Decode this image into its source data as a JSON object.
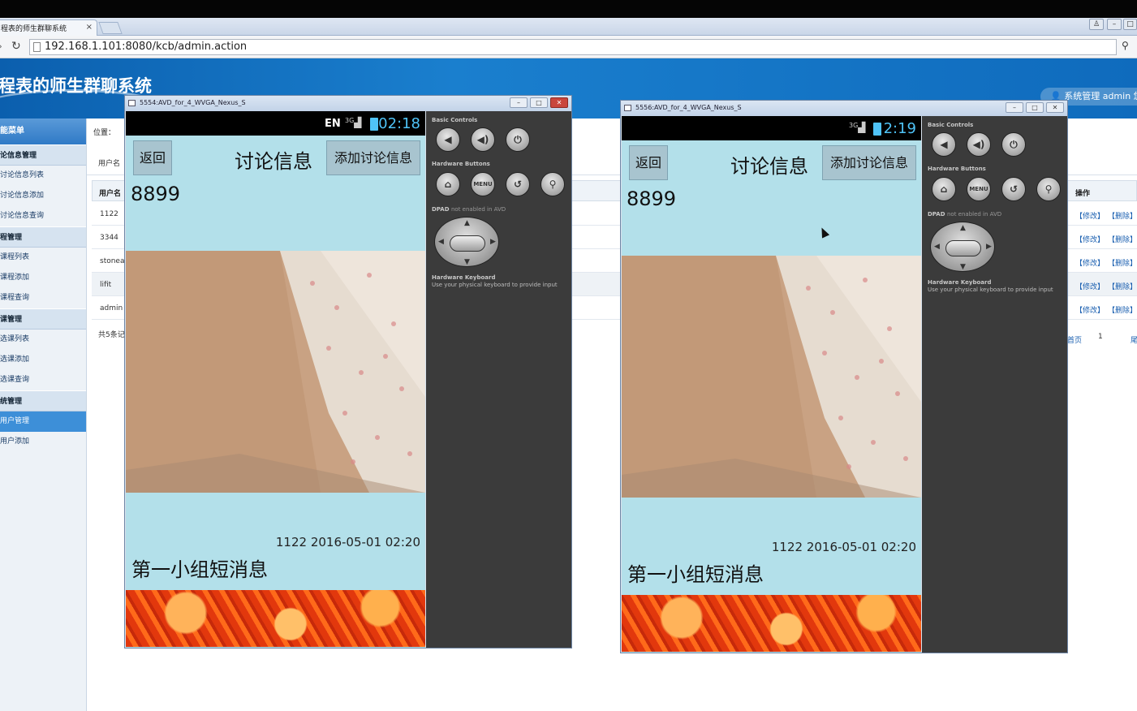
{
  "browser": {
    "tab_title": "程表的师生群聊系统",
    "tab_close": "×",
    "url": "192.168.1.101:8080/kcb/admin.action"
  },
  "site": {
    "title": "程表的师生群聊系统",
    "userinfo": "系统管理 admin 您"
  },
  "sidebar": {
    "head": "能菜单",
    "groups": [
      {
        "label": "论信息管理",
        "items": [
          "讨论信息列表",
          "讨论信息添加",
          "讨论信息查询"
        ]
      },
      {
        "label": "程管理",
        "items": [
          "课程列表",
          "课程添加",
          "课程查询"
        ]
      },
      {
        "label": "课管理",
        "items": [
          "选课列表",
          "选课添加",
          "选课查询"
        ]
      },
      {
        "label": "统管理",
        "items": [
          "用户管理",
          "用户添加"
        ]
      }
    ]
  },
  "content": {
    "location": "位置：",
    "filter_label": "用户名",
    "col_user": "用户名",
    "col_action": "操作",
    "rows": [
      "1122",
      "3344",
      "stonea",
      "lifit",
      "admin"
    ],
    "edit": "【修改】",
    "delete": "【删除】",
    "total": "共5条记",
    "first_page": "首页",
    "page_no": "1",
    "last": "尾"
  },
  "emulators": [
    {
      "title": "5554:AVD_for_4_WVGA_Nexus_S",
      "clock": "02:18",
      "ime": "EN",
      "net": "3G"
    },
    {
      "title": "5556:AVD_for_4_WVGA_Nexus_S",
      "clock": "2:19",
      "net": "3G"
    }
  ],
  "app": {
    "back": "返回",
    "title": "讨论信息",
    "add": "添加讨论信息",
    "user_id": "8899",
    "meta": "1122  2016-05-01 02:20",
    "message": "第一小组短消息"
  },
  "controls": {
    "basic": "Basic Controls",
    "hardware": "Hardware Buttons",
    "menu": "MENU",
    "dpad": "DPAD",
    "dpad_note": "not enabled in AVD",
    "keyboard": "Hardware Keyboard",
    "keyboard_note": "Use your physical keyboard to provide input"
  }
}
